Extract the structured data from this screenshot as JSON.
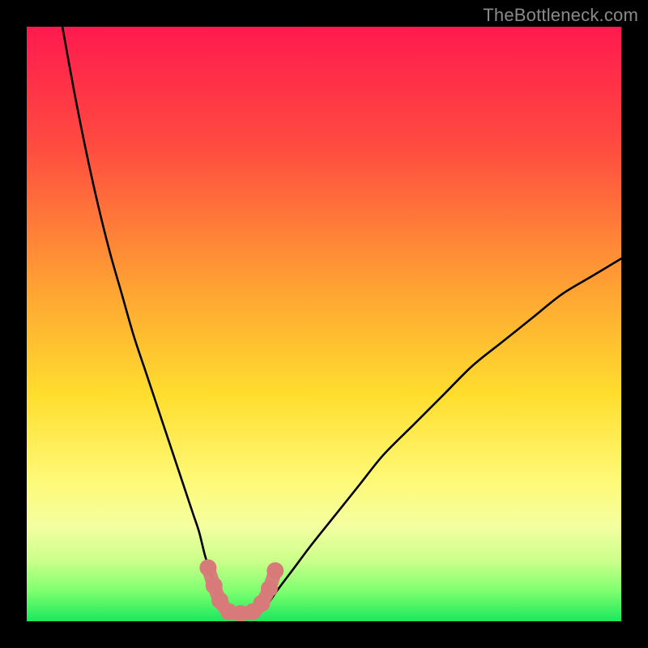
{
  "watermark": "TheBottleneck.com",
  "colors": {
    "black": "#000000",
    "curve": "#000000",
    "marker": "#d97a7a",
    "marker_stroke": "#8f4a4a"
  },
  "chart_data": {
    "type": "line",
    "title": "",
    "xlabel": "",
    "ylabel": "",
    "xlim": [
      0,
      100
    ],
    "ylim": [
      0,
      100
    ],
    "gradient_stops": [
      {
        "offset": 0,
        "color": "#ff1a4e"
      },
      {
        "offset": 20,
        "color": "#ff4b40"
      },
      {
        "offset": 45,
        "color": "#ffa632"
      },
      {
        "offset": 62,
        "color": "#ffde2e"
      },
      {
        "offset": 76,
        "color": "#fff976"
      },
      {
        "offset": 84,
        "color": "#f4ffa0"
      },
      {
        "offset": 90,
        "color": "#c9ff8a"
      },
      {
        "offset": 95,
        "color": "#7dff6f"
      },
      {
        "offset": 100,
        "color": "#19e85d"
      }
    ],
    "series": [
      {
        "name": "left-curve",
        "x": [
          6,
          8,
          10,
          12,
          14,
          16,
          18,
          20,
          22,
          24,
          26,
          27,
          28,
          29,
          30,
          31,
          32,
          33
        ],
        "y": [
          100,
          89,
          79,
          70,
          62,
          55,
          48,
          42,
          36,
          30,
          24,
          21,
          18,
          15,
          11,
          8,
          5,
          2
        ]
      },
      {
        "name": "right-curve",
        "x": [
          40,
          42,
          45,
          48,
          52,
          56,
          60,
          65,
          70,
          75,
          80,
          85,
          90,
          95,
          100
        ],
        "y": [
          2,
          5,
          9,
          13,
          18,
          23,
          28,
          33,
          38,
          43,
          47,
          51,
          55,
          58,
          61
        ]
      },
      {
        "name": "valley-floor",
        "x": [
          33,
          35,
          37,
          40
        ],
        "y": [
          2,
          1.2,
          1.2,
          2
        ]
      }
    ],
    "markers": [
      {
        "x": 30.5,
        "y": 9
      },
      {
        "x": 31.5,
        "y": 6
      },
      {
        "x": 32.5,
        "y": 3.5
      },
      {
        "x": 34,
        "y": 1.6
      },
      {
        "x": 36,
        "y": 1.3
      },
      {
        "x": 38,
        "y": 1.6
      },
      {
        "x": 39.5,
        "y": 3
      },
      {
        "x": 40.8,
        "y": 5.5
      },
      {
        "x": 41.8,
        "y": 8.5
      }
    ]
  }
}
